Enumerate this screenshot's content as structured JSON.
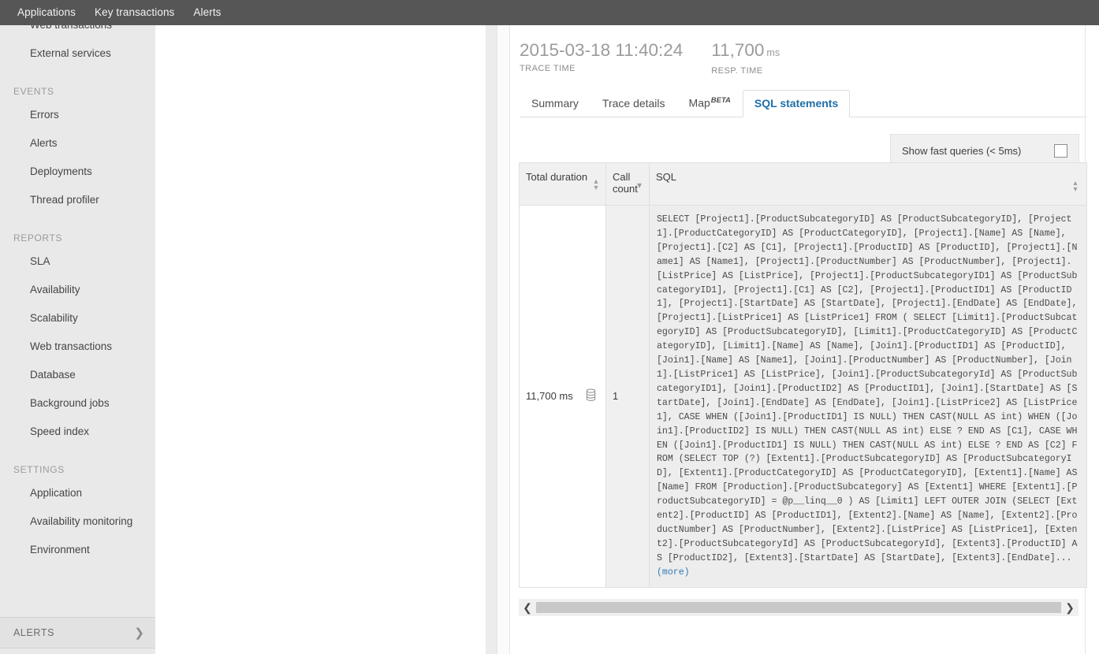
{
  "topnav": {
    "items": [
      {
        "label": "Applications"
      },
      {
        "label": "Key transactions"
      },
      {
        "label": "Alerts"
      }
    ]
  },
  "sidebar": {
    "clipped_item": {
      "label": "Web transactions"
    },
    "items": [
      {
        "type": "link",
        "label": "External services"
      },
      {
        "type": "section",
        "label": "EVENTS"
      },
      {
        "type": "link",
        "label": "Errors"
      },
      {
        "type": "link",
        "label": "Alerts"
      },
      {
        "type": "link",
        "label": "Deployments"
      },
      {
        "type": "link",
        "label": "Thread profiler"
      },
      {
        "type": "section",
        "label": "REPORTS"
      },
      {
        "type": "link",
        "label": "SLA"
      },
      {
        "type": "link",
        "label": "Availability"
      },
      {
        "type": "link",
        "label": "Scalability"
      },
      {
        "type": "link",
        "label": "Web transactions"
      },
      {
        "type": "link",
        "label": "Database"
      },
      {
        "type": "link",
        "label": "Background jobs"
      },
      {
        "type": "link",
        "label": "Speed index"
      },
      {
        "type": "section",
        "label": "SETTINGS"
      },
      {
        "type": "link",
        "label": "Application"
      },
      {
        "type": "link",
        "label": "Availability monitoring"
      },
      {
        "type": "link",
        "label": "Environment"
      }
    ],
    "alerts_bar": {
      "label": "ALERTS",
      "chevron": "chevron-right-icon"
    }
  },
  "trace": {
    "time_value": "2015-03-18 11:40:24",
    "time_label": "TRACE TIME",
    "resp_value": "11,700",
    "resp_unit": "ms",
    "resp_label": "RESP. TIME"
  },
  "tabs": [
    {
      "label": "Summary",
      "active": false
    },
    {
      "label": "Trace details",
      "active": false
    },
    {
      "label": "Map",
      "superscript": "BETA",
      "active": false
    },
    {
      "label": "SQL statements",
      "active": true
    }
  ],
  "fast_queries": {
    "label": "Show fast queries (< 5ms)",
    "checked": false
  },
  "table": {
    "columns": [
      {
        "label": "Total duration",
        "sort": "both"
      },
      {
        "label": "Call count",
        "sort": "desc"
      },
      {
        "label": "SQL",
        "sort": "both"
      }
    ],
    "rows": [
      {
        "total_duration": "11,700 ms",
        "icon": "database-icon",
        "call_count": "1",
        "sql": "SELECT [Project1].[ProductSubcategoryID] AS [ProductSubcategoryID], [Project1].[ProductCategoryID] AS [ProductCategoryID], [Project1].[Name] AS [Name], [Project1].[C2] AS [C1], [Project1].[ProductID] AS [ProductID], [Project1].[Name1] AS [Name1], [Project1].[ProductNumber] AS [ProductNumber], [Project1].[ListPrice] AS [ListPrice], [Project1].[ProductSubcategoryID1] AS [ProductSubcategoryID1], [Project1].[C1] AS [C2], [Project1].[ProductID1] AS [ProductID1], [Project1].[StartDate] AS [StartDate], [Project1].[EndDate] AS [EndDate], [Project1].[ListPrice1] AS [ListPrice1] FROM ( SELECT [Limit1].[ProductSubcategoryID] AS [ProductSubcategoryID], [Limit1].[ProductCategoryID] AS [ProductCategoryID], [Limit1].[Name] AS [Name], [Join1].[ProductID1] AS [ProductID], [Join1].[Name] AS [Name1], [Join1].[ProductNumber] AS [ProductNumber], [Join1].[ListPrice1] AS [ListPrice], [Join1].[ProductSubcategoryId] AS [ProductSubcategoryID1], [Join1].[ProductID2] AS [ProductID1], [Join1].[StartDate] AS [StartDate], [Join1].[EndDate] AS [EndDate], [Join1].[ListPrice2] AS [ListPrice1], CASE WHEN ([Join1].[ProductID1] IS NULL) THEN CAST(NULL AS int) WHEN ([Join1].[ProductID2] IS NULL) THEN CAST(NULL AS int) ELSE ? END AS [C1], CASE WHEN ([Join1].[ProductID1] IS NULL) THEN CAST(NULL AS int) ELSE ? END AS [C2] FROM (SELECT TOP (?) [Extent1].[ProductSubcategoryID] AS [ProductSubcategoryID], [Extent1].[ProductCategoryID] AS [ProductCategoryID], [Extent1].[Name] AS [Name] FROM [Production].[ProductSubcategory] AS [Extent1] WHERE [Extent1].[ProductSubcategoryID] = @p__linq__0 ) AS [Limit1] LEFT OUTER JOIN (SELECT [Extent2].[ProductID] AS [ProductID1], [Extent2].[Name] AS [Name], [Extent2].[ProductNumber] AS [ProductNumber], [Extent2].[ListPrice] AS [ListPrice1], [Extent2].[ProductSubcategoryId] AS [ProductSubcategoryId], [Extent3].[ProductID] AS [ProductID2], [Extent3].[StartDate] AS [StartDate], [Extent3].[EndDate]... ",
        "more_label": "(more)"
      }
    ]
  },
  "hscroll": {
    "left_arrow": "chevron-left-icon",
    "right_arrow": "chevron-right-icon"
  }
}
